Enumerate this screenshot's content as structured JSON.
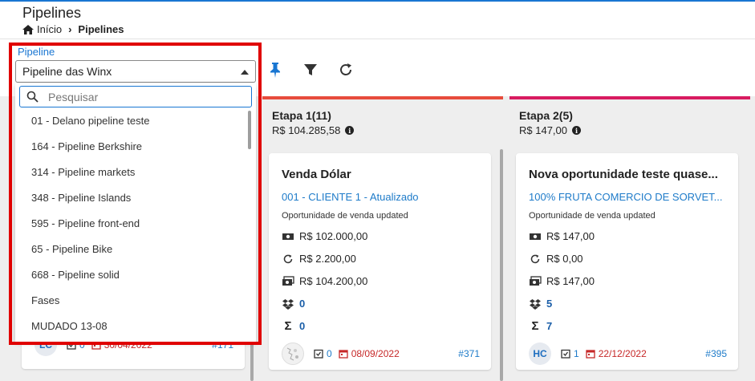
{
  "header": {
    "title": "Pipelines",
    "breadcrumb": {
      "home": "Início",
      "current": "Pipelines"
    }
  },
  "pipeline_select": {
    "label": "Pipeline",
    "value": "Pipeline das Winx",
    "search_placeholder": "Pesquisar",
    "options": [
      "01 - Delano pipeline teste",
      "164 - Pipeline Berkshire",
      "314 - Pipeline markets",
      "348 - Pipeline Islands",
      "595 - Pipeline front-end",
      "65 - Pipeline Bike",
      "668 - Pipeline solid",
      "Fases",
      "MUDADO 13-08"
    ]
  },
  "toolbar": {
    "icons": [
      "pin-icon",
      "filter-icon",
      "refresh-icon"
    ]
  },
  "columns": [
    {
      "title": "Etapa 1(11)",
      "total": "R$ 104.285,58",
      "color": "#e74c3c",
      "card": {
        "title": "Venda Dólar",
        "client": "001 - CLIENTE 1 - Atualizado",
        "description": "Oportunidade de venda updated",
        "value": "R$ 102.000,00",
        "recurring": "R$ 2.200,00",
        "total": "R$ 104.200,00",
        "products": "0",
        "sum": "0",
        "tasks": "0",
        "date": "08/09/2022",
        "id": "#371"
      }
    },
    {
      "title": "Etapa 2(5)",
      "total": "R$ 147,00",
      "color": "#d81b60",
      "card": {
        "title": "Nova oportunidade teste quase...",
        "client": "100% FRUTA COMERCIO DE SORVET...",
        "description": "Oportunidade de venda updated",
        "value": "R$ 147,00",
        "recurring": "R$ 0,00",
        "total": "R$ 147,00",
        "products": "5",
        "sum": "7",
        "avatar": "HC",
        "tasks": "1",
        "date": "22/12/2022",
        "id": "#395"
      }
    }
  ],
  "hidden_card_footer": {
    "avatar": "LC",
    "tasks": "0",
    "date": "30/04/2022",
    "id": "#171"
  },
  "colors": {
    "accent": "#1976d2",
    "highlight": "#e00000",
    "date_red": "#c62828",
    "link_blue": "#1e7bc9"
  }
}
